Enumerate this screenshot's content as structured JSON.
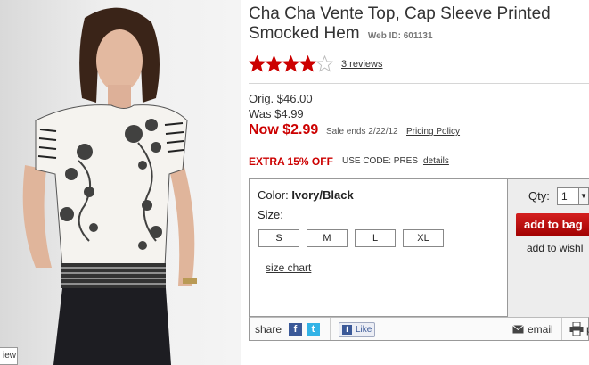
{
  "product": {
    "title": "Cha Cha Vente Top, Cap Sleeve Printed Smocked Hem",
    "web_id_label": "Web ID: 601131",
    "rating": 4,
    "rating_max": 5,
    "reviews_link": "3 reviews"
  },
  "photo": {
    "view_tag": "iew"
  },
  "pricing": {
    "orig": "Orig. $46.00",
    "was": "Was $4.99",
    "now": "Now $2.99",
    "sale_ends": "Sale ends 2/22/12",
    "policy_link": "Pricing Policy",
    "extra_offer": "EXTRA 15% OFF",
    "use_code": "USE CODE: PRES",
    "details_link": "details"
  },
  "options": {
    "color_label": "Color:",
    "color_value": "Ivory/Black",
    "size_label": "Size:",
    "sizes": [
      "S",
      "M",
      "L",
      "XL"
    ],
    "size_chart_link": "size chart"
  },
  "purchase": {
    "qty_label": "Qty:",
    "qty_value": "1",
    "add_to_bag": "add to bag",
    "wishlist_link": "add to wishl"
  },
  "share": {
    "share_label": "share",
    "like_label": "Like",
    "email_label": "email",
    "print_label": "p"
  },
  "colors": {
    "accent_red": "#cc0000",
    "facebook_blue": "#3b5998",
    "twitter_blue": "#33b3e6"
  }
}
